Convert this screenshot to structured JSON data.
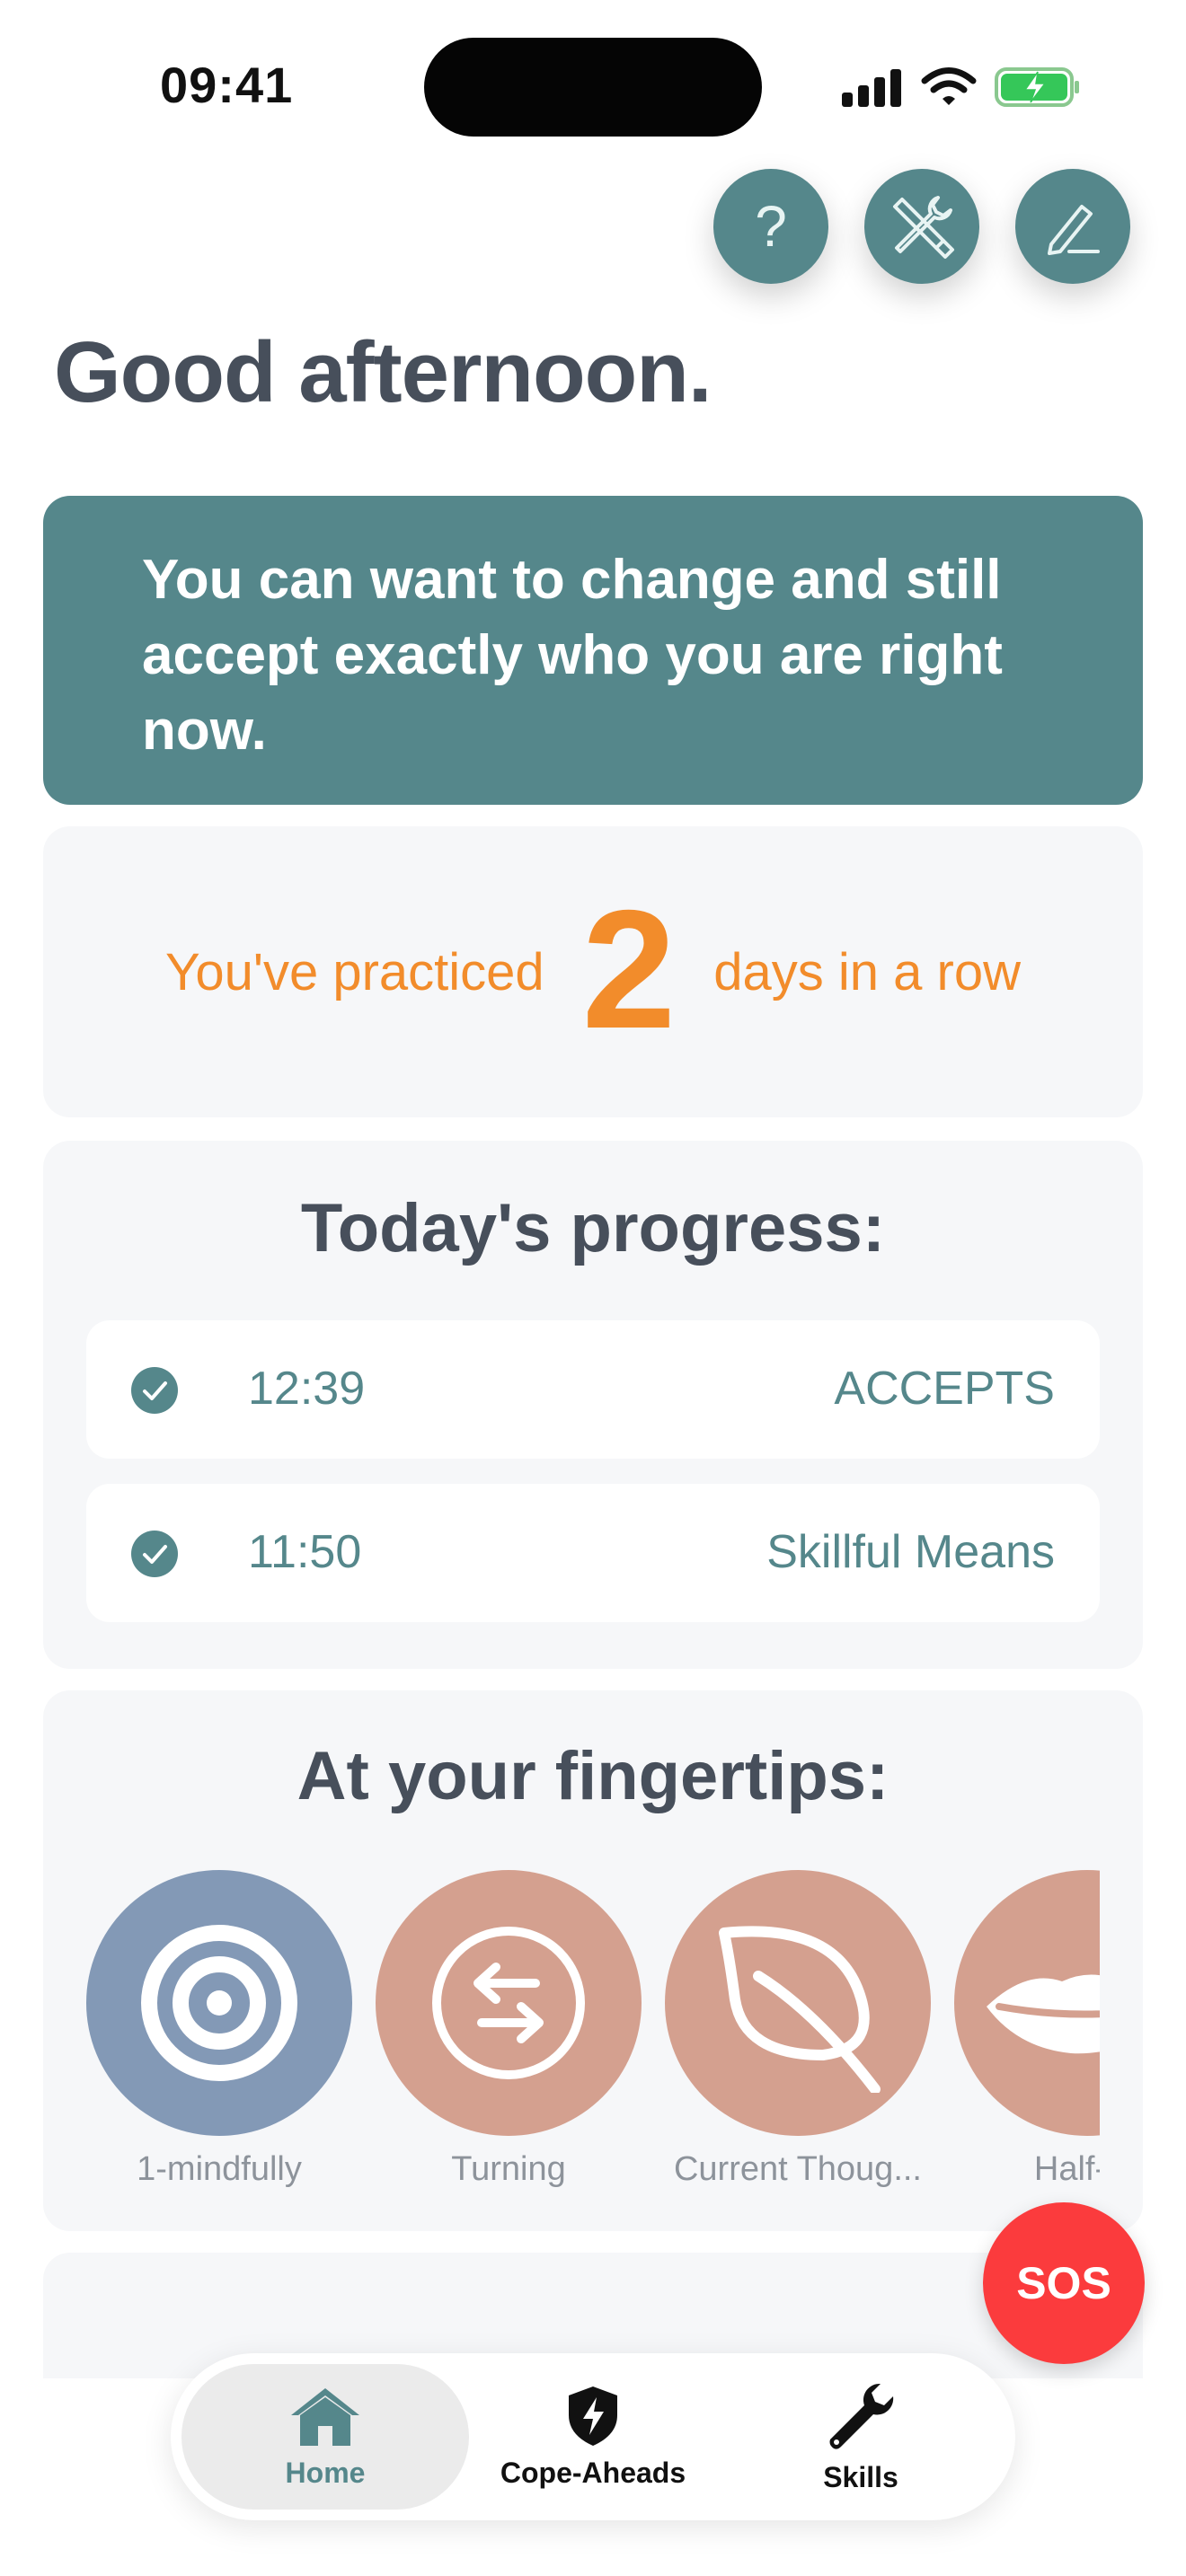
{
  "status_bar": {
    "time": "09:41",
    "icons": [
      "cellular-signal-icon",
      "wifi-icon",
      "battery-charging-icon"
    ]
  },
  "top_buttons": [
    {
      "id": "help",
      "icon": "question-mark-icon"
    },
    {
      "id": "tools",
      "icon": "tools-icon"
    },
    {
      "id": "edit",
      "icon": "pencil-icon"
    }
  ],
  "greeting": "Good afternoon.",
  "quote": "You can want to change and still accept exactly who you are right now.",
  "streak": {
    "prefix": "You've practiced",
    "count": "2",
    "suffix": "days in a row"
  },
  "progress": {
    "title": "Today's progress:",
    "rows": [
      {
        "time": "12:39",
        "skill": "ACCEPTS"
      },
      {
        "time": "11:50",
        "skill": "Skillful Means"
      }
    ]
  },
  "tips": {
    "title": "At your fingertips:",
    "items": [
      {
        "label": "1-mindfully",
        "icon": "target-icon",
        "color": "#8399b6"
      },
      {
        "label": "Turning",
        "icon": "swap-arrows-icon",
        "color": "#d4a08f"
      },
      {
        "label": "Current Thoug...",
        "icon": "leaf-icon",
        "color": "#d4a08f"
      },
      {
        "label": "Half-Sr",
        "icon": "lips-icon",
        "color": "#d4a08f"
      }
    ]
  },
  "sos": "SOS",
  "tab_bar": {
    "tabs": [
      {
        "label": "Home",
        "icon": "home-icon",
        "selected": true
      },
      {
        "label": "Cope-Aheads",
        "icon": "shield-bolt-icon",
        "selected": false
      },
      {
        "label": "Skills",
        "icon": "wrench-icon",
        "selected": false
      }
    ]
  },
  "colors": {
    "teal": "#55878b",
    "orange": "#f28c2b",
    "card_bg": "#f6f7f9",
    "sos_red": "#fb3b3d",
    "text_dark": "#474f5b"
  }
}
